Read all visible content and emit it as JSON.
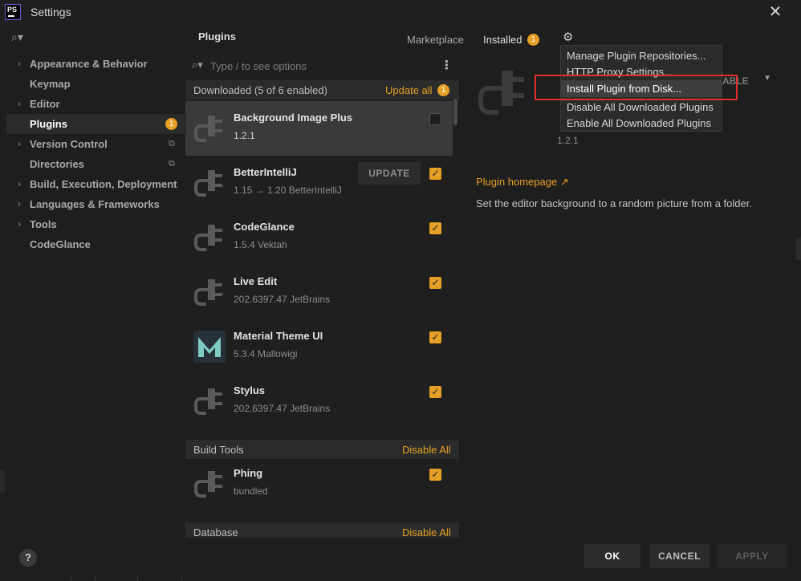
{
  "window": {
    "title": "Settings",
    "logo_text": "PS",
    "close_glyph": "✕"
  },
  "sidebar": {
    "search_glyph": "⌕▾",
    "items": [
      {
        "label": "Appearance & Behavior",
        "expandable": true
      },
      {
        "label": "Keymap",
        "expandable": false
      },
      {
        "label": "Editor",
        "expandable": true
      },
      {
        "label": "Plugins",
        "expandable": false,
        "badge": "1",
        "active": true
      },
      {
        "label": "Version Control",
        "expandable": true,
        "copy_icon": true
      },
      {
        "label": "Directories",
        "expandable": false,
        "copy_icon": true
      },
      {
        "label": "Build, Execution, Deployment",
        "expandable": true
      },
      {
        "label": "Languages & Frameworks",
        "expandable": true
      },
      {
        "label": "Tools",
        "expandable": true
      },
      {
        "label": "CodeGlance",
        "expandable": false
      }
    ]
  },
  "header": {
    "title": "Plugins",
    "tabs": [
      {
        "label": "Marketplace",
        "active": false
      },
      {
        "label": "Installed",
        "active": true,
        "badge": "1"
      }
    ],
    "gear_icon": "gear-icon"
  },
  "list": {
    "search_placeholder": "Type / to see options",
    "groups": [
      {
        "name": "Downloaded (5 of 6 enabled)",
        "action": "Update all",
        "badge": "1"
      },
      {
        "name": "Build Tools",
        "action": "Disable All"
      },
      {
        "name": "Database",
        "action": "Disable All"
      }
    ],
    "plugins": [
      {
        "name": "Background Image Plus",
        "meta": "1.2.1",
        "checked": false,
        "selected": true
      },
      {
        "name": "BetterIntelliJ",
        "meta": "1.15 → 1.20  BetterIntelliJ",
        "checked": true,
        "update_label": "UPDATE"
      },
      {
        "name": "CodeGlance",
        "meta": "1.5.4  Vektah",
        "checked": true
      },
      {
        "name": "Live Edit",
        "meta": "202.6397.47  JetBrains",
        "checked": true
      },
      {
        "name": "Material Theme UI",
        "meta": "5.3.4  Mallowigi",
        "checked": true,
        "icon": "material-theme-icon"
      },
      {
        "name": "Stylus",
        "meta": "202.6397.47  JetBrains",
        "checked": true
      },
      {
        "name": "Phing",
        "meta": "bundled",
        "checked": true
      }
    ]
  },
  "detail": {
    "version": "1.2.1",
    "enable_label": "ABLE",
    "homepage_label": "Plugin homepage ↗",
    "description": "Set the editor background to a random picture from a folder."
  },
  "gear_menu": {
    "items": [
      "Manage Plugin Repositories...",
      "HTTP Proxy Settings...",
      "Install Plugin from Disk...",
      "Disable All Downloaded Plugins",
      "Enable All Downloaded Plugins"
    ],
    "highlighted_index": 2,
    "highlight_color": "#e02e2e"
  },
  "footer": {
    "help_glyph": "?",
    "ok": "OK",
    "cancel": "CANCEL",
    "apply": "APPLY"
  },
  "colors": {
    "accent": "#e5a025",
    "background": "#1e1e1e",
    "selected_row": "#3a3a3a"
  }
}
